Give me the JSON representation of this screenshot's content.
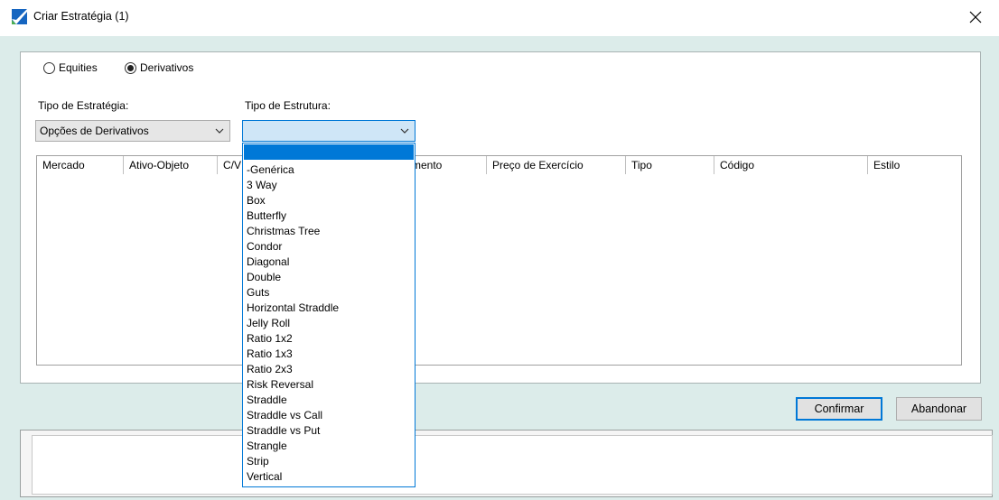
{
  "window": {
    "title": "Criar Estratégia (1)",
    "close_glyph": "✕"
  },
  "colors": {
    "accent": "#0078d7",
    "window_bg": "#dcecea"
  },
  "market_type": {
    "options": [
      {
        "label": "Equities",
        "checked": false
      },
      {
        "label": "Derivativos",
        "checked": true
      }
    ]
  },
  "strategy_type": {
    "label": "Tipo de Estratégia:",
    "value": "Opções de Derivativos"
  },
  "structure_type": {
    "label": "Tipo de Estrutura:",
    "value": "",
    "options": [
      "-Genérica",
      "3 Way",
      "Box",
      "Butterfly",
      "Christmas Tree",
      "Condor",
      "Diagonal",
      "Double",
      "Guts",
      "Horizontal Straddle",
      "Jelly Roll",
      "Ratio 1x2",
      "Ratio 1x3",
      "Ratio 2x3",
      "Risk Reversal",
      "Straddle",
      "Straddle vs Call",
      "Straddle vs Put",
      "Strangle",
      "Strip",
      "Vertical"
    ]
  },
  "grid": {
    "columns": [
      "Mercado",
      "Ativo-Objeto",
      "C/V",
      "mento",
      "Preço de Exercício",
      "Tipo",
      "Código",
      "Estilo"
    ]
  },
  "buttons": {
    "confirm": "Confirmar",
    "cancel": "Abandonar"
  }
}
